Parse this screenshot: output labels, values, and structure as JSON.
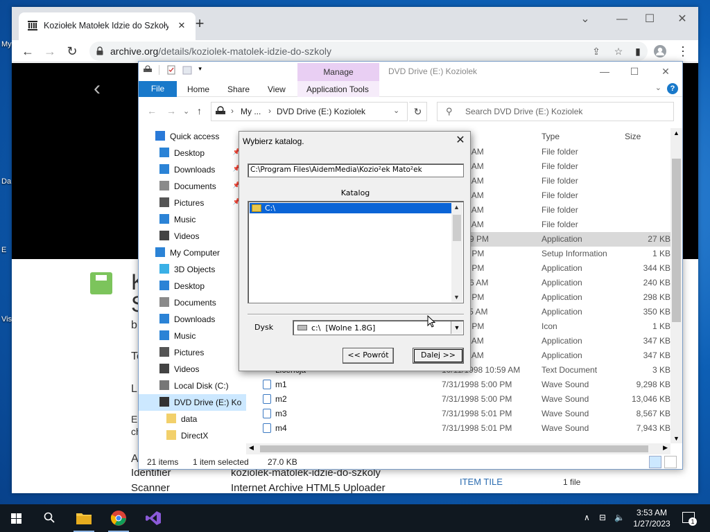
{
  "desktop": {
    "icons": [
      {
        "label": "My",
        "name": "desktop-icon-my-computer"
      },
      {
        "label": "Da",
        "name": "desktop-icon-data"
      },
      {
        "label": "E",
        "name": "desktop-icon-e"
      },
      {
        "label": "Vis",
        "name": "desktop-icon-visual-studio"
      }
    ]
  },
  "browser": {
    "tab_title": "Koziołek Matołek Idzie do Szkoły",
    "new_tab": "+",
    "url_host": "archive.org",
    "url_path": "/details/koziolek-matolek-idzie-do-szkoly",
    "controls": {
      "minimize": "—",
      "maximize": "☐",
      "close": "✕",
      "tabsearch": "⌄"
    }
  },
  "page": {
    "title_fragments": [
      "K",
      "S",
      "b"
    ],
    "left_letters": [
      "Te",
      "L",
      "E",
      "ch",
      "A"
    ],
    "meta": [
      {
        "label": "Identifier",
        "value": "koziolek-matolek-idzie-do-szkoly"
      },
      {
        "label": "Scanner",
        "value": "Internet Archive HTML5 Uploader"
      }
    ],
    "item_tile": "ITEM TILE",
    "item_count": "1 file"
  },
  "explorer": {
    "title": "DVD Drive (E:) Koziolek",
    "manage_label": "Manage",
    "ribbon_tabs": {
      "file": "File",
      "home": "Home",
      "share": "Share",
      "view": "View",
      "app_tools": "Application Tools"
    },
    "address": {
      "crumb1": "My ...",
      "crumb2": "DVD Drive (E:) Koziolek"
    },
    "search_placeholder": "Search DVD Drive (E:) Koziolek",
    "columns": {
      "date": "odified",
      "type": "Type",
      "size": "Size"
    },
    "nav": [
      {
        "label": "Quick access",
        "icon": "star-icon",
        "pinned": false
      },
      {
        "label": "Desktop",
        "icon": "desktop-icon",
        "pinned": true
      },
      {
        "label": "Downloads",
        "icon": "download-icon",
        "pinned": true
      },
      {
        "label": "Documents",
        "icon": "document-icon",
        "pinned": true
      },
      {
        "label": "Pictures",
        "icon": "pictures-icon",
        "pinned": true
      },
      {
        "label": "Music",
        "icon": "music-icon",
        "pinned": false
      },
      {
        "label": "Videos",
        "icon": "video-icon",
        "pinned": false
      },
      {
        "label": "My Computer",
        "icon": "computer-icon",
        "pinned": false
      },
      {
        "label": "3D Objects",
        "icon": "cube-icon",
        "pinned": false
      },
      {
        "label": "Desktop",
        "icon": "desktop-icon",
        "pinned": false
      },
      {
        "label": "Documents",
        "icon": "document-icon",
        "pinned": false
      },
      {
        "label": "Downloads",
        "icon": "download-icon",
        "pinned": false
      },
      {
        "label": "Music",
        "icon": "music-icon",
        "pinned": false
      },
      {
        "label": "Pictures",
        "icon": "pictures-icon",
        "pinned": false
      },
      {
        "label": "Videos",
        "icon": "video-icon",
        "pinned": false
      },
      {
        "label": "Local Disk (C:)",
        "icon": "drive-icon",
        "pinned": false
      },
      {
        "label": "DVD Drive (E:) Ko",
        "icon": "dvd-icon",
        "pinned": false,
        "selected": true
      },
      {
        "label": "data",
        "icon": "folder-icon",
        "pinned": false
      },
      {
        "label": "DirectX",
        "icon": "folder-icon",
        "pinned": false
      }
    ],
    "files": [
      {
        "name": "",
        "date": "99 5:10 AM",
        "type": "File folder",
        "size": ""
      },
      {
        "name": "",
        "date": "99 5:10 AM",
        "type": "File folder",
        "size": ""
      },
      {
        "name": "",
        "date": "99 5:10 AM",
        "type": "File folder",
        "size": ""
      },
      {
        "name": "",
        "date": "99 5:10 AM",
        "type": "File folder",
        "size": ""
      },
      {
        "name": "",
        "date": "99 5:10 AM",
        "type": "File folder",
        "size": ""
      },
      {
        "name": "",
        "date": "99 5:10 AM",
        "type": "File folder",
        "size": ""
      },
      {
        "name": "",
        "date": "998 5:39 PM",
        "type": "Application",
        "size": "27 KB",
        "selected": true
      },
      {
        "name": "",
        "date": "98 6:28 PM",
        "type": "Setup Information",
        "size": "1 KB"
      },
      {
        "name": "",
        "date": "98 1:45 PM",
        "type": "Application",
        "size": "344 KB"
      },
      {
        "name": "",
        "date": "998 5:16 AM",
        "type": "Application",
        "size": "240 KB"
      },
      {
        "name": "",
        "date": "98 2:29 PM",
        "type": "Application",
        "size": "298 KB"
      },
      {
        "name": "",
        "date": "99 11:45 AM",
        "type": "Application",
        "size": "350 KB"
      },
      {
        "name": "",
        "date": "98 3:26 PM",
        "type": "Icon",
        "size": "1 KB"
      },
      {
        "name": "",
        "date": "98 4:56 AM",
        "type": "Application",
        "size": "347 KB"
      },
      {
        "name": "",
        "date": "8 10:58 AM",
        "type": "Application",
        "size": "347 KB"
      },
      {
        "name": "Licencja",
        "date": "10/11/1998 10:59 AM",
        "type": "Text Document",
        "size": "3 KB"
      },
      {
        "name": "m1",
        "date": "7/31/1998 5:00 PM",
        "type": "Wave Sound",
        "size": "9,298 KB",
        "icon": "audio-file-icon"
      },
      {
        "name": "m2",
        "date": "7/31/1998 5:00 PM",
        "type": "Wave Sound",
        "size": "13,046 KB",
        "icon": "audio-file-icon"
      },
      {
        "name": "m3",
        "date": "7/31/1998 5:01 PM",
        "type": "Wave Sound",
        "size": "8,567 KB",
        "icon": "audio-file-icon"
      },
      {
        "name": "m4",
        "date": "7/31/1998 5:01 PM",
        "type": "Wave Sound",
        "size": "7,943 KB",
        "icon": "audio-file-icon"
      }
    ],
    "status": {
      "items": "21 items",
      "selected": "1 item selected",
      "size": "27.0 KB"
    }
  },
  "dialog": {
    "title": "Wybierz katalog.",
    "path_value": "C:\\Program Files\\AidemMedia\\Kozio²ek Mato²ek",
    "katalog_label": "Katalog",
    "list_selected": "C:\\",
    "drive_label": "Dysk",
    "drive_value": "c:\\  [Wolne 1.8G]",
    "back_button": "<< Powrót",
    "next_button": "Dalej >>"
  },
  "taskbar": {
    "time": "3:53 AM",
    "date": "1/27/2023",
    "notification_count": "1"
  },
  "colors": {
    "accent": "#1979ca",
    "manage_band": "#e9cff3",
    "selection_blue": "#0a64d6"
  }
}
